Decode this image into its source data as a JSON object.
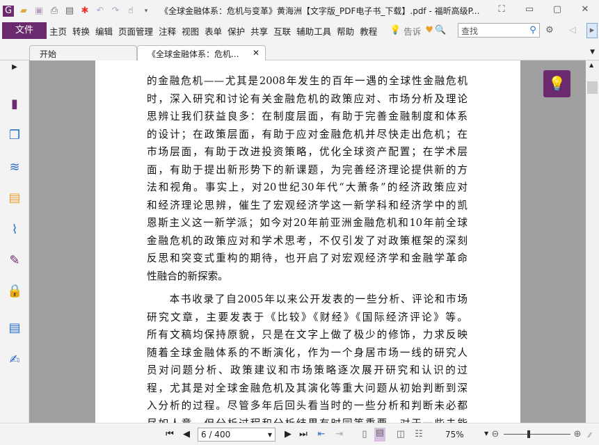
{
  "title": "《全球金融体系：危机与变革》黄海洲【文字版_PDF电子书_下载】.pdf - 福昕高级P...",
  "menu": {
    "file": "文件",
    "items": [
      "主页",
      "转换",
      "编辑",
      "页面管理",
      "注释",
      "视图",
      "表单",
      "保护",
      "共享",
      "互联",
      "辅助工具",
      "帮助",
      "教程"
    ],
    "tell": "告诉",
    "search_placeholder": "查找"
  },
  "tabs": [
    {
      "label": "开始"
    },
    {
      "label": "《全球金融体系：危机..."
    }
  ],
  "content": {
    "lines": [
      "的金融危机——尤其是2008年发生的百年一遇的全球性金融危机",
      "时，深入研究和讨论有关金融危机的政策应对、市场分析及理论",
      "思辨让我们获益良多：在制度层面，有助于完善金融制度和体系",
      "的设计；在政策层面，有助于应对金融危机并尽快走出危机；在",
      "市场层面，有助于改进投资策略，优化全球资产配置；在学术层",
      "面，有助于提出新形势下的新课题，为完善经济理论提供新的方",
      "法和视角。事实上，对20世纪30年代“大萧条”的经济政策应对",
      "和经济理论思辨，催生了宏观经济学这一新学科和经济学中的凯",
      "恩斯主义这一新学派；如今对20年前亚洲金融危机和10年前全球",
      "金融危机的政策应对和学术思考，不仅引发了对政策框架的深刻",
      "反思和突变式重构的期待，也开启了对宏观经济学和金融学革命",
      "性融合的新探索。",
      "　　本书收录了自2005年以来公开发表的一些分析、评论和市场",
      "研究文章，主要发表于《比较》《财经》《国际经济评论》等。",
      "所有文稿均保持原貌，只是在文字上做了极少的修饰，力求反映",
      "随着全球金融体系的不断演化，作为一个身居市场一线的研究人",
      "员对问题分析、政策建议和市场策略逐次展开研究和认识的过",
      "程，尤其是对全球金融危机及其演化等重大问题从初始判断到深",
      "入分析的过程。尽管多年后回头看当时的一些分析和判断未必都",
      "尽如人意，但分析过程和分析结果有时同等重要。对于一些未能"
    ]
  },
  "status": {
    "page": "6 / 400",
    "zoom": "75%"
  }
}
